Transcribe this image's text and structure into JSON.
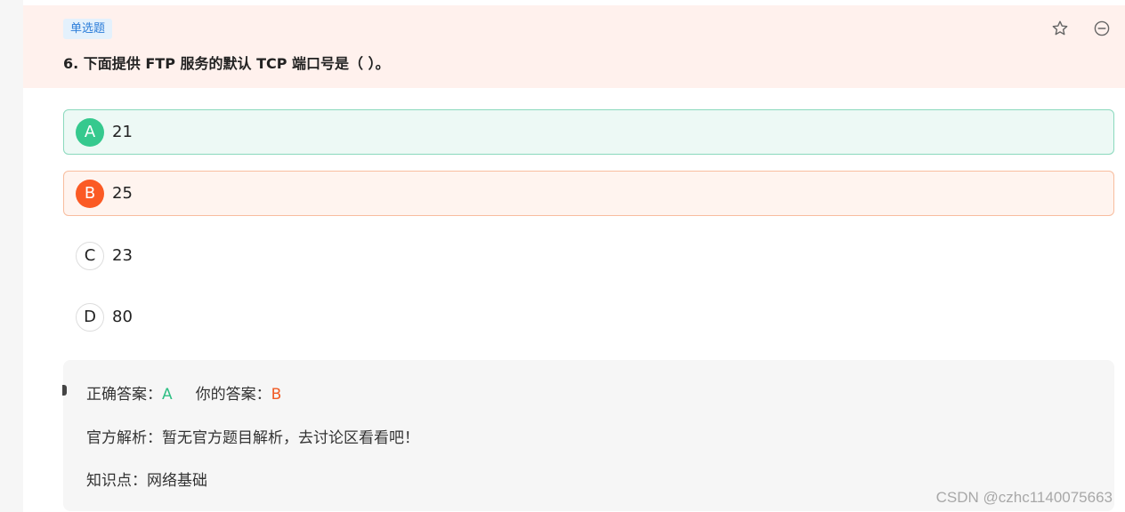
{
  "question": {
    "type_tag": "单选题",
    "title": "6. 下面提供 FTP 服务的默认 TCP 端口号是（ ）。",
    "icons": [
      "star-icon",
      "minus-circle-icon"
    ]
  },
  "options": [
    {
      "letter": "A",
      "text": "21",
      "state": "correct"
    },
    {
      "letter": "B",
      "text": "25",
      "state": "wrong"
    },
    {
      "letter": "C",
      "text": "23",
      "state": "plain"
    },
    {
      "letter": "D",
      "text": "80",
      "state": "plain"
    }
  ],
  "analysis": {
    "correct_label": "正确答案：",
    "correct_value": "A",
    "your_label": "你的答案：",
    "your_value": "B",
    "official_label": "官方解析：",
    "official_text": "暂无官方题目解析，去讨论区看看吧！",
    "knowledge_label": "知识点：",
    "knowledge_text": "网络基础"
  },
  "colors": {
    "correct": "#36c98e",
    "wrong": "#fb5a24",
    "header_bg": "#fff1ed"
  },
  "watermark": "CSDN @czhc1140075663"
}
